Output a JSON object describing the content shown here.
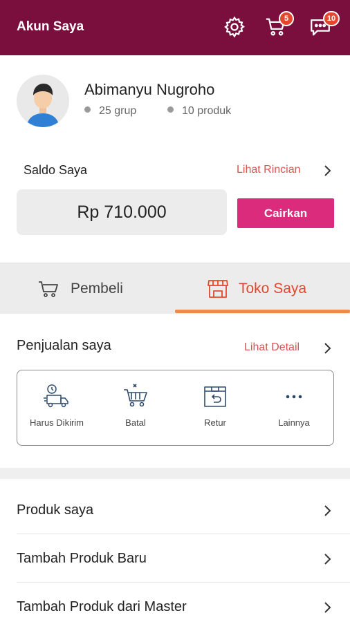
{
  "header": {
    "title": "Akun Saya",
    "cart_count": "5",
    "chat_count": "10",
    "bg_color": "#7a0f3e",
    "badge_color": "#e4472d",
    "icons": [
      "gear-icon",
      "cart-icon",
      "chat-icon"
    ]
  },
  "profile": {
    "name": "Abimanyu Nugroho",
    "groups": "25 grup",
    "products": "10 produk"
  },
  "balance": {
    "label": "Saldo Saya",
    "details_link": "Lihat Rincian",
    "amount": "Rp 710.000",
    "withdraw_label": "Cairkan",
    "link_color": "#d9534f",
    "button_color": "#da2b7d"
  },
  "tabs": [
    {
      "label": "Pembeli",
      "active": false,
      "icon": "cart-outline-icon"
    },
    {
      "label": "Toko Saya",
      "active": true,
      "icon": "store-icon",
      "color": "#e4472d"
    }
  ],
  "sales": {
    "title": "Penjualan saya",
    "details_link": "Lihat Detail",
    "items": [
      {
        "label": "Harus Dikirim",
        "icon": "delivery-truck-icon"
      },
      {
        "label": "Batal",
        "icon": "cancel-cart-icon"
      },
      {
        "label": "Retur",
        "icon": "return-box-icon"
      },
      {
        "label": "Lainnya",
        "icon": "more-dots-icon"
      }
    ]
  },
  "menu": [
    {
      "label": "Produk saya"
    },
    {
      "label": "Tambah Produk Baru"
    },
    {
      "label": "Tambah Produk dari Master"
    }
  ]
}
